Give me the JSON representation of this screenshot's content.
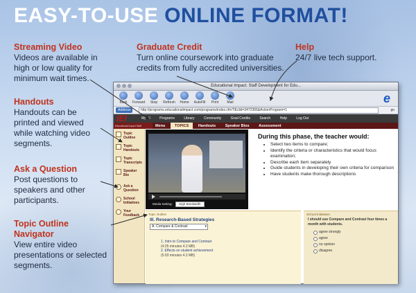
{
  "headline": {
    "part1": "EASY-TO-USE",
    "part2": "ONLINE FORMAT!"
  },
  "callouts": {
    "streaming": {
      "title": "Streaming Video",
      "desc": "Videos are available in high or low quality for minimum wait times."
    },
    "graduate": {
      "title": "Graduate Credit",
      "desc": "Turn online coursework into graduate credits from fully accredited universities."
    },
    "help": {
      "title": "Help",
      "desc": "24/7 live tech support."
    },
    "handouts": {
      "title": "Handouts",
      "desc": "Handouts can be printed and viewed while watching video segments."
    },
    "ask": {
      "title": "Ask a Question",
      "desc": "Post questions to speakers and other participants."
    },
    "outline": {
      "title": "Topic Outline Navigator",
      "desc": "View entire video presentations or selected segments."
    }
  },
  "browser": {
    "title": "Educational Impact: Staff Development for Edu...",
    "toolbar": [
      {
        "label": "Back",
        "icon": "back-arrow-icon"
      },
      {
        "label": "Forward",
        "icon": "forward-arrow-icon"
      },
      {
        "label": "Stop",
        "icon": "stop-icon"
      },
      {
        "label": "Refresh",
        "icon": "refresh-icon"
      },
      {
        "label": "Home",
        "icon": "home-icon"
      },
      {
        "label": "AutoFill",
        "icon": "autofill-icon"
      },
      {
        "label": "Print",
        "icon": "print-icon"
      },
      {
        "label": "Mail",
        "icon": "mail-icon"
      }
    ],
    "address_label": "Address",
    "address_value": "http://programs.educationalimpact.com/programs/index.cfm?IEclid=3472366&ActionProgram=1",
    "go_label": "go"
  },
  "site": {
    "logo": "IEI",
    "brand_strip": "Educational Impact Staff Development",
    "topnav": [
      "My EI",
      "Programs",
      "Library",
      "Community",
      "Grad Credits",
      "Search",
      "Help",
      "Log Out"
    ],
    "tabs": [
      {
        "label": "Menu",
        "active": false
      },
      {
        "label": "TOPICS",
        "active": true
      },
      {
        "label": "Handouts",
        "active": false
      },
      {
        "label": "Speaker Bios",
        "active": false
      },
      {
        "label": "Assessment",
        "active": false
      }
    ],
    "sidebar": [
      {
        "label": "Topic Outline",
        "icon": "outline-icon"
      },
      {
        "label": "Topic Handouts",
        "icon": "handout-icon"
      },
      {
        "label": "Topic Transcripts",
        "icon": "transcript-icon"
      },
      {
        "label": "Speaker Bio",
        "icon": "speaker-icon"
      },
      {
        "label": "Ask a Question",
        "icon": "question-icon"
      },
      {
        "label": "School Initiatives",
        "icon": "school-icon"
      },
      {
        "label": "Your Feedback",
        "icon": "feedback-icon"
      }
    ],
    "video": {
      "media_label": "Media Setting:",
      "media_value": "High Bandwidth"
    },
    "lesson": {
      "heading": "During this phase, the teacher would:",
      "bullets": [
        "Select two items to compare;",
        "Identify the criteria or characteristics that would focus examination;",
        "Describe each item separately",
        "Guide students in developing their own criteria for comparison",
        "Have students make thorough descriptions"
      ]
    },
    "outline": {
      "header": "Topic Outline",
      "title": "III. Research-Based Strategies",
      "dropdown": "A. Compare & Contrast",
      "entries": [
        {
          "title": "1. Intro to Compare and Contrast",
          "time": "(4:25 minutes 4.2 MB)"
        },
        {
          "title": "2. Effects on student achievement",
          "time": "(5:03 minutes 4.2 MB)"
        }
      ]
    },
    "quiz": {
      "header": "School Initiatives",
      "question": "I should use Compare and Contrast four times a month with students.",
      "options": [
        "agree strongly",
        "agree",
        "no opinion",
        "disagree"
      ]
    }
  },
  "colors": {
    "accent_red": "#c0331d",
    "headline_blue": "#1f4f9e",
    "site_maroon": "#5c1717"
  }
}
